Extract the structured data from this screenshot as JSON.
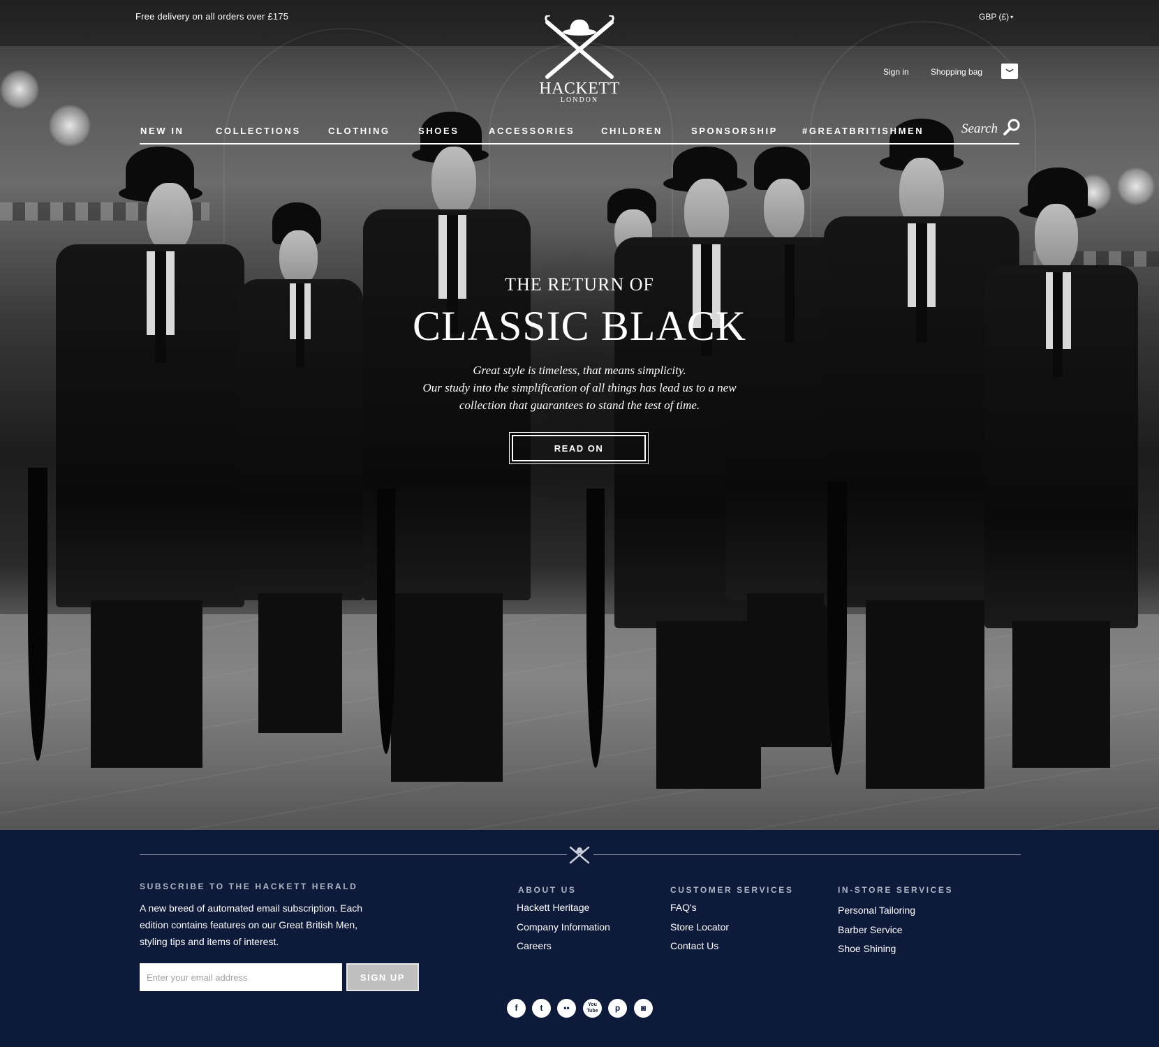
{
  "header": {
    "promo": "Free delivery on all orders over £175",
    "currency": "GBP (£)",
    "logo_name": "HACKETT",
    "logo_sub": "LONDON",
    "sign_in": "Sign in",
    "shopping_bag": "Shopping bag",
    "search_label": "Search"
  },
  "nav": {
    "items": [
      "NEW IN",
      "COLLECTIONS",
      "CLOTHING",
      "SHOES",
      "ACCESSORIES",
      "CHILDREN",
      "SPONSORSHIP",
      "#GREATBRITISHMEN"
    ]
  },
  "hero": {
    "pretitle": "THE RETURN OF",
    "title": "CLASSIC BLACK",
    "body_lines": [
      "Great style is timeless, that means simplicity.",
      "Our study into the simplification of all things has lead us to a new",
      "collection that guarantees to stand the test of time."
    ],
    "cta": "READ ON"
  },
  "footer": {
    "subscribe_heading": "SUBSCRIBE TO THE HACKETT HERALD",
    "subscribe_lines": [
      "A new breed of automated email subscription.  Each",
      "edition contains features on our Great British Men,",
      "styling tips and items of interest."
    ],
    "email_placeholder": "Enter your email address",
    "signup_label": "SIGN UP",
    "about": {
      "heading": "ABOUT US",
      "links": [
        "Hackett Heritage",
        "Company Information",
        "Careers"
      ]
    },
    "customer": {
      "heading": "CUSTOMER SERVICES",
      "links": [
        "FAQ's",
        "Store Locator",
        "Contact Us"
      ]
    },
    "instore": {
      "heading": "IN-STORE SERVICES",
      "links": [
        "Personal Tailoring",
        "Barber Service",
        "Shoe Shining"
      ]
    },
    "socials": [
      {
        "name": "facebook-icon",
        "glyph": "f"
      },
      {
        "name": "twitter-icon",
        "glyph": "t"
      },
      {
        "name": "flickr-icon",
        "glyph": "••"
      },
      {
        "name": "youtube-icon",
        "glyph": "You\nTube"
      },
      {
        "name": "pinterest-icon",
        "glyph": "p"
      },
      {
        "name": "instagram-icon",
        "glyph": "◙"
      }
    ]
  },
  "colors": {
    "footer_bg": "#0d1a3a",
    "footer_heading": "#aeb6c6",
    "accent_white": "#ffffff"
  }
}
